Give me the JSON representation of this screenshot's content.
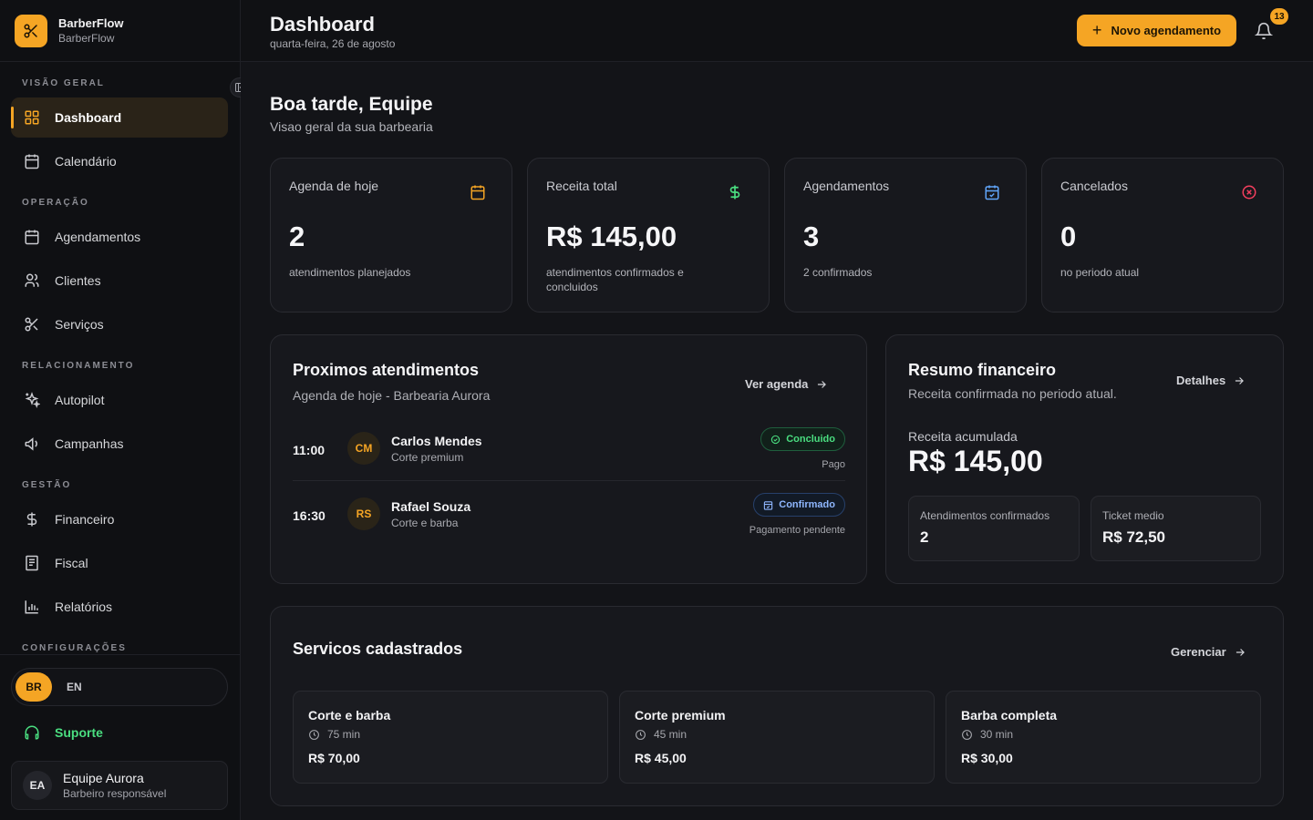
{
  "brand": {
    "name": "BarberFlow",
    "subtitle": "BarberFlow"
  },
  "sidebar": {
    "sections": {
      "overview": "VISÃO GERAL",
      "operation": "OPERAÇÃO",
      "relationship": "RELACIONAMENTO",
      "management": "GESTÃO",
      "settings": "CONFIGURAÇÕES"
    },
    "items": {
      "dashboard": "Dashboard",
      "calendar": "Calendário",
      "appointments": "Agendamentos",
      "clients": "Clientes",
      "services": "Serviços",
      "autopilot": "Autopilot",
      "campaigns": "Campanhas",
      "financial": "Financeiro",
      "fiscal": "Fiscal",
      "reports": "Relatórios"
    },
    "lang": {
      "br": "BR",
      "en": "EN"
    },
    "support": "Suporte",
    "user": {
      "initials": "EA",
      "name": "Equipe Aurora",
      "role": "Barbeiro responsável"
    }
  },
  "header": {
    "title": "Dashboard",
    "date": "quarta-feira, 26 de agosto",
    "new_button": "Novo agendamento",
    "notification_count": "13"
  },
  "greeting": {
    "title": "Boa tarde, Equipe",
    "subtitle": "Visao geral da sua barbearia"
  },
  "stats": [
    {
      "label": "Agenda de hoje",
      "value": "2",
      "desc": "atendimentos planejados",
      "icon": "calendar-icon",
      "color": "#f5a524"
    },
    {
      "label": "Receita total",
      "value": "R$ 145,00",
      "desc": "atendimentos confirmados e concluidos",
      "icon": "dollar-icon",
      "color": "#4ade80"
    },
    {
      "label": "Agendamentos",
      "value": "3",
      "desc": "2 confirmados",
      "icon": "calendar-check-icon",
      "color": "#60a5fa"
    },
    {
      "label": "Cancelados",
      "value": "0",
      "desc": "no periodo atual",
      "icon": "x-circle-icon",
      "color": "#f43f5e"
    }
  ],
  "upcoming": {
    "title": "Proximos atendimentos",
    "subtitle": "Agenda de hoje - Barbearia Aurora",
    "link": "Ver agenda",
    "rows": [
      {
        "time": "11:00",
        "initials": "CM",
        "name": "Carlos Mendes",
        "service": "Corte premium",
        "status": "Concluido",
        "payment": "Pago"
      },
      {
        "time": "16:30",
        "initials": "RS",
        "name": "Rafael Souza",
        "service": "Corte e barba",
        "status": "Confirmado",
        "payment": "Pagamento pendente"
      }
    ]
  },
  "financial": {
    "title": "Resumo financeiro",
    "subtitle": "Receita confirmada no periodo atual.",
    "link": "Detalhes",
    "accumulated_label": "Receita acumulada",
    "accumulated_value": "R$ 145,00",
    "confirmed_label": "Atendimentos confirmados",
    "confirmed_value": "2",
    "ticket_label": "Ticket medio",
    "ticket_value": "R$ 72,50"
  },
  "services": {
    "title": "Servicos cadastrados",
    "link": "Gerenciar",
    "items": [
      {
        "name": "Corte e barba",
        "duration": "75 min",
        "price": "R$ 70,00"
      },
      {
        "name": "Corte premium",
        "duration": "45 min",
        "price": "R$ 45,00"
      },
      {
        "name": "Barba completa",
        "duration": "30 min",
        "price": "R$ 30,00"
      }
    ]
  },
  "colors": {
    "accent": "#f5a524",
    "success": "#4ade80",
    "info": "#60a5fa",
    "danger": "#f43f5e"
  }
}
